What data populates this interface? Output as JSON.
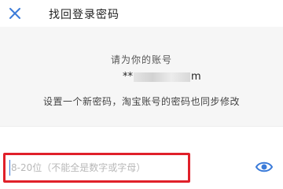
{
  "header": {
    "close_icon": "close-icon",
    "title": "找回登录密码"
  },
  "content": {
    "prompt": "请为你的账号",
    "account_prefix": "**",
    "account_suffix": "m",
    "instruction": "设置一个新密码，淘宝账号的密码也同步修改"
  },
  "password_field": {
    "value": "",
    "placeholder": "8-20位（不能全是数字或字母）",
    "visibility_icon": "eye-icon"
  },
  "colors": {
    "accent": "#3b7bd9",
    "highlight": "#e0202a",
    "background": "#f6f6f6"
  }
}
